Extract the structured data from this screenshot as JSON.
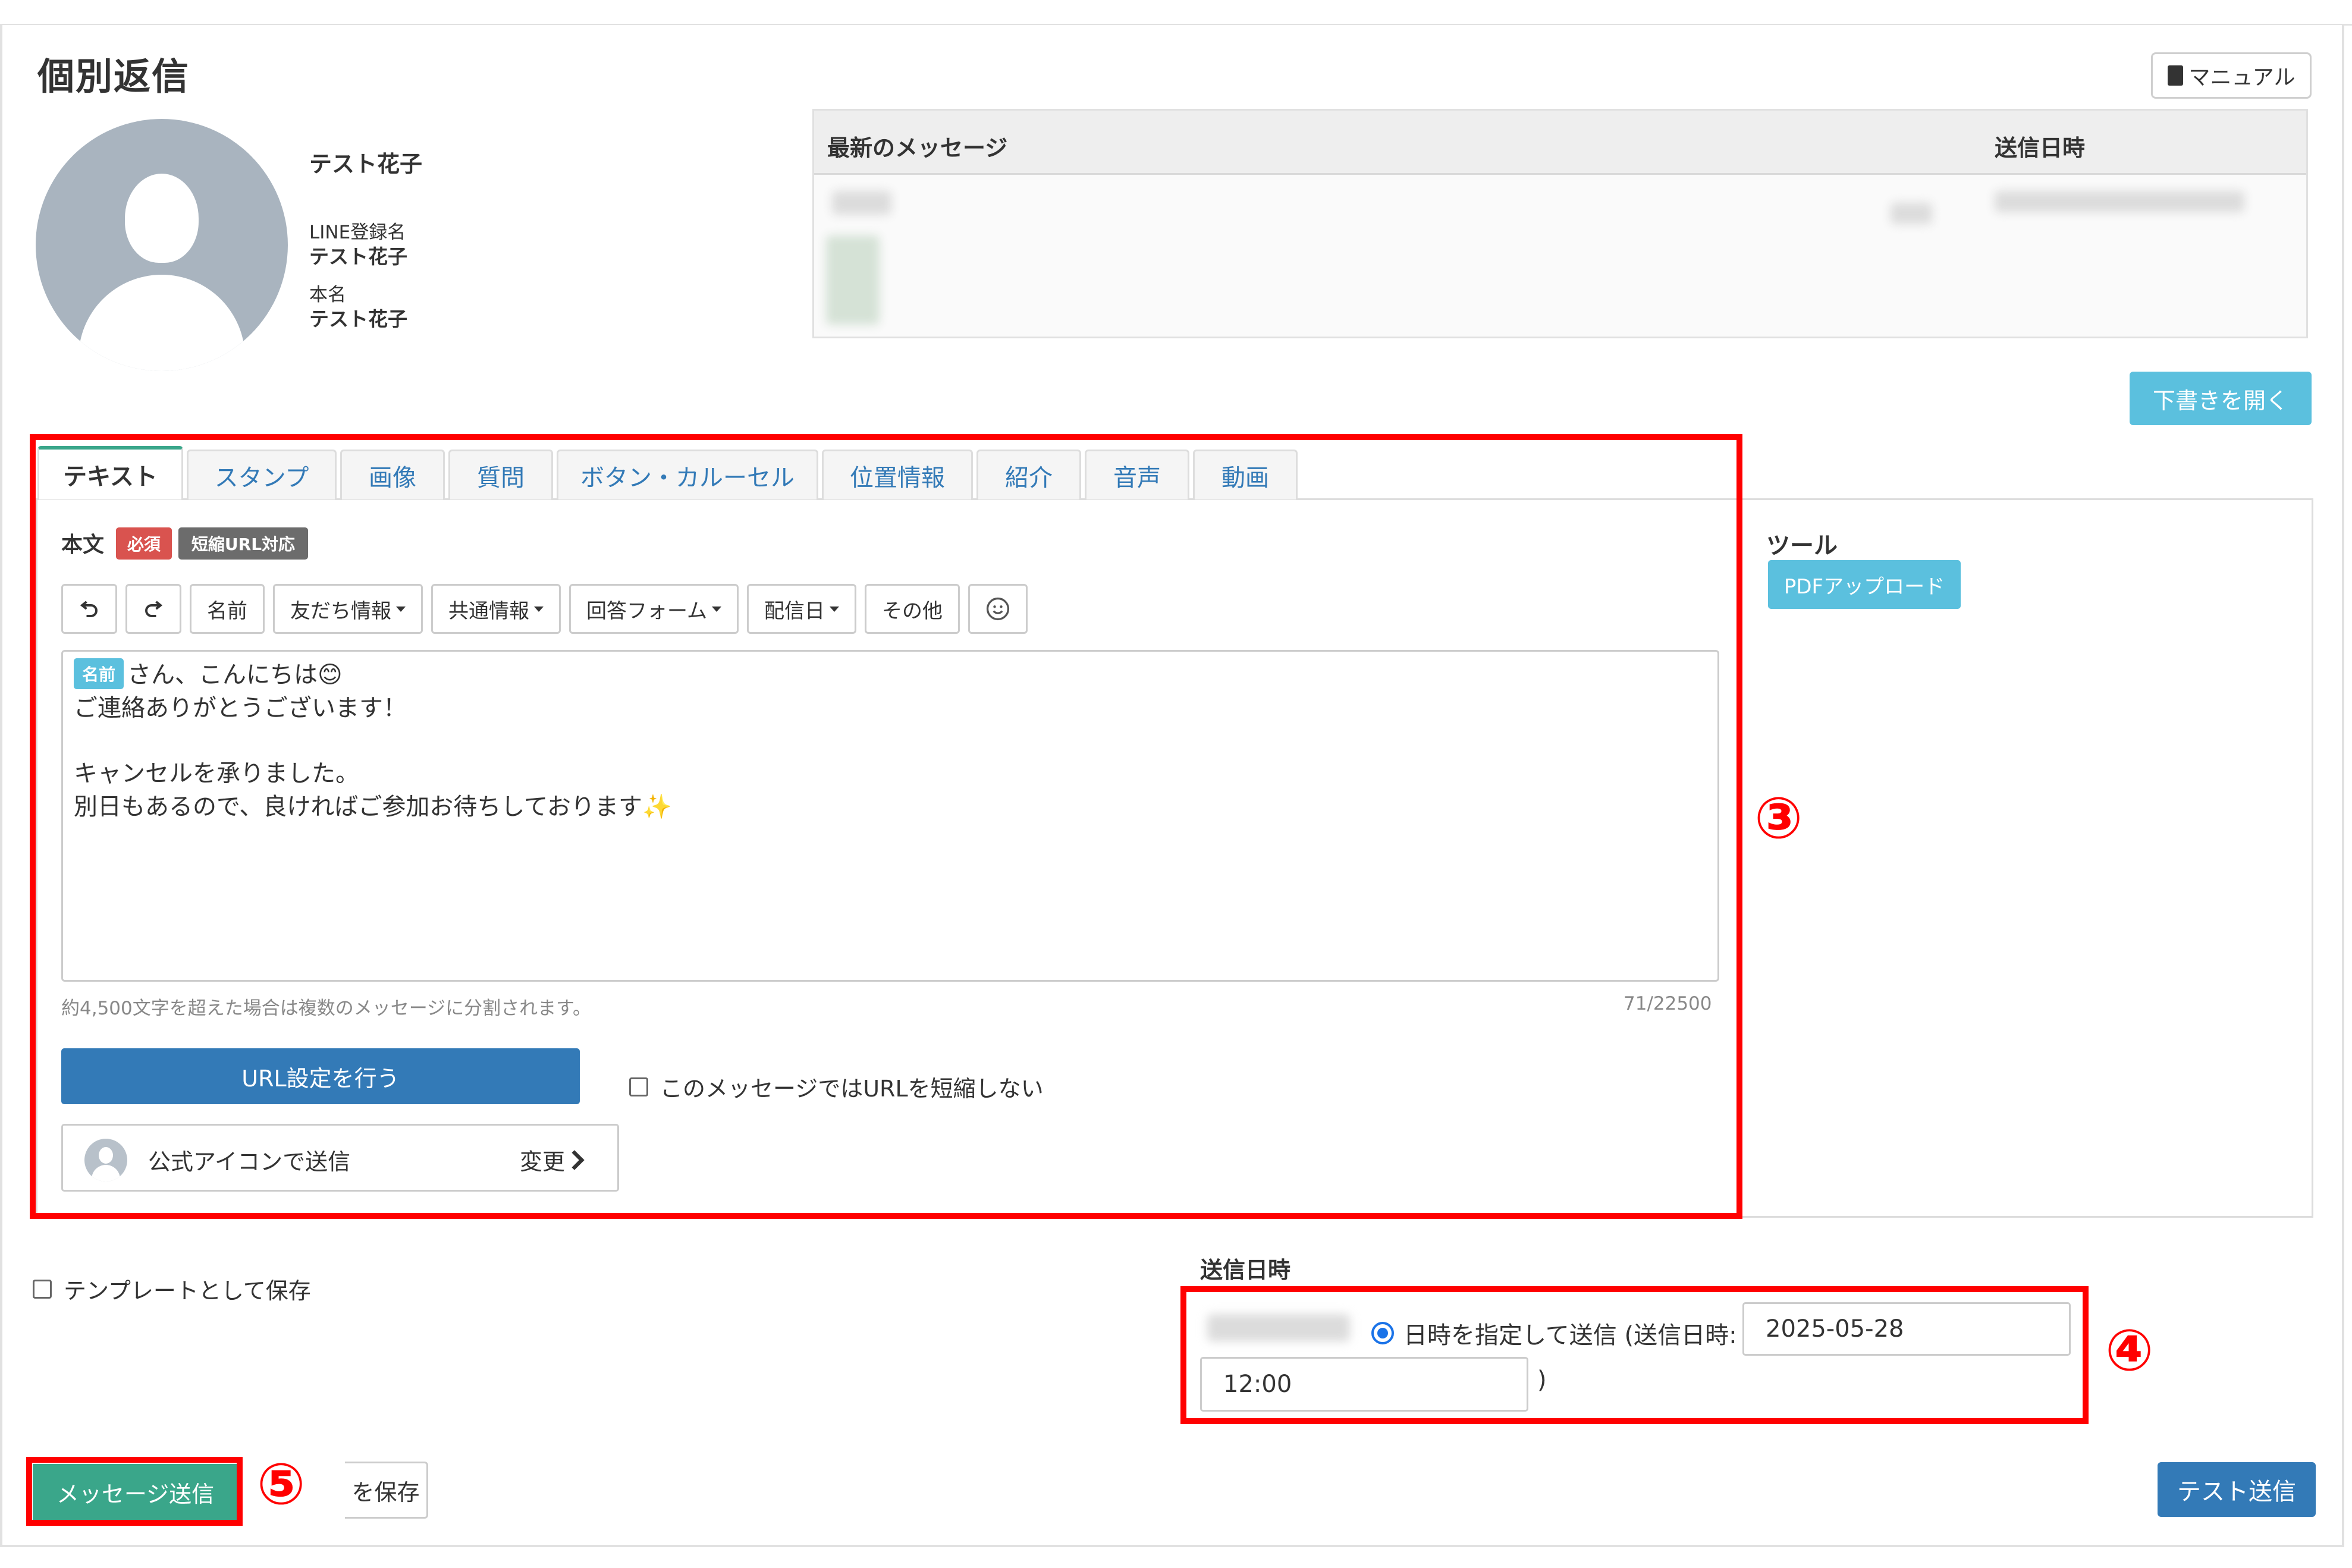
{
  "page": {
    "title": "個別返信",
    "manual_label": "マニュアル"
  },
  "profile": {
    "display_name": "テスト花子",
    "line_name_label": "LINE登録名",
    "line_name": "テスト花子",
    "real_name_label": "本名",
    "real_name": "テスト花子"
  },
  "latest_messages": {
    "col_message": "最新のメッセージ",
    "col_sent_at": "送信日時"
  },
  "draft_button": "下書きを開く",
  "tabs": [
    {
      "label": "テキスト",
      "active": true
    },
    {
      "label": "スタンプ"
    },
    {
      "label": "画像"
    },
    {
      "label": "質問"
    },
    {
      "label": "ボタン・カルーセル"
    },
    {
      "label": "位置情報"
    },
    {
      "label": "紹介"
    },
    {
      "label": "音声"
    },
    {
      "label": "動画"
    }
  ],
  "editor": {
    "body_label": "本文",
    "required_badge": "必須",
    "short_url_badge": "短縮URL対応",
    "toolbar": {
      "name": "名前",
      "friend_info": "友だち情報",
      "common_info": "共通情報",
      "answer_form": "回答フォーム",
      "delivery_date": "配信日",
      "other": "その他"
    },
    "name_chip": "名前",
    "lines": [
      "さん、こんにちは😊",
      "ご連絡ありがとうございます！",
      "",
      "キャンセルを承りました。",
      "別日もあるので、良ければご参加お待ちしております✨"
    ],
    "hint": "約4,500文字を超えた場合は複数のメッセージに分割されます。",
    "char_count": "71/22500",
    "url_settings_button": "URL設定を行う",
    "no_shorten_label": "このメッセージではURLを短縮しない",
    "send_icon_label": "公式アイコンで送信",
    "change_label": "変更"
  },
  "tools": {
    "title": "ツール",
    "pdf_upload": "PDFアップロード"
  },
  "annotations": {
    "n3": "③",
    "n4": "④",
    "n5": "⑤"
  },
  "save_template_label": "テンプレートとして保存",
  "schedule": {
    "title": "送信日時",
    "radio_label": "日時を指定して送信 (送信日時:",
    "date_value": "2025-05-28",
    "time_value": "12:00",
    "close_paren": ")"
  },
  "footer": {
    "send_message": "メッセージ送信",
    "save_partial": "を保存",
    "test_send": "テスト送信"
  },
  "colors": {
    "accent_green": "#3aa68a",
    "primary_blue": "#337ab7",
    "info_cyan": "#5bc0de",
    "annotation_red": "#ff0000"
  }
}
